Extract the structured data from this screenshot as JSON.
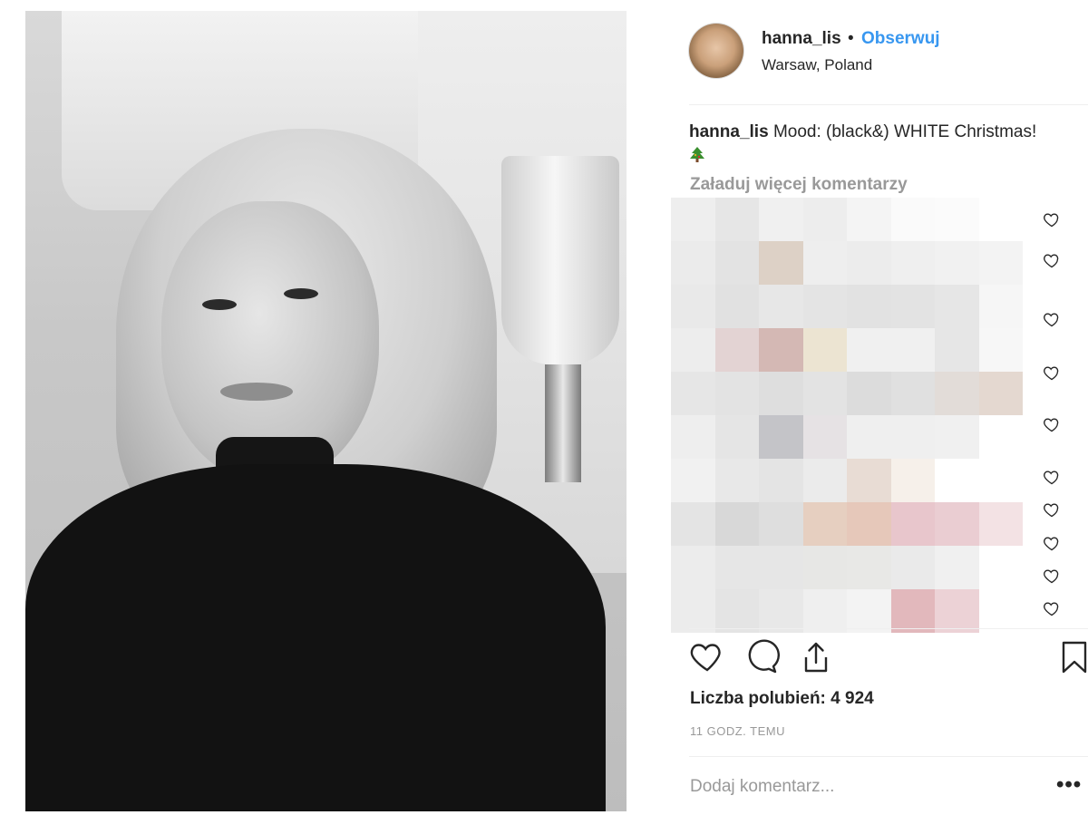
{
  "post": {
    "username": "hanna_lis",
    "separator": "•",
    "follow_label": "Obserwuj",
    "location": "Warsaw, Poland"
  },
  "caption": {
    "username": "hanna_lis",
    "text": "Mood: (black&) WHITE Christmas!",
    "emoji_icon": "christmas-tree-icon"
  },
  "comments": {
    "load_more_label": "Załaduj więcej komentarzy",
    "pixelated": true,
    "like_icon": "heart-outline-icon"
  },
  "actions": {
    "like_icon": "heart-outline-icon",
    "comment_icon": "speech-bubble-icon",
    "share_icon": "share-upload-icon",
    "save_icon": "bookmark-icon"
  },
  "stats": {
    "likes_text": "Liczba polubień: 4 924",
    "time_ago": "11 GODZ. TEMU"
  },
  "comment_input": {
    "placeholder": "Dodaj komentarz...",
    "more_label": "•••"
  },
  "colors": {
    "link_blue": "#3897f0",
    "text": "#262626",
    "muted": "#999999",
    "border": "#efefef"
  }
}
